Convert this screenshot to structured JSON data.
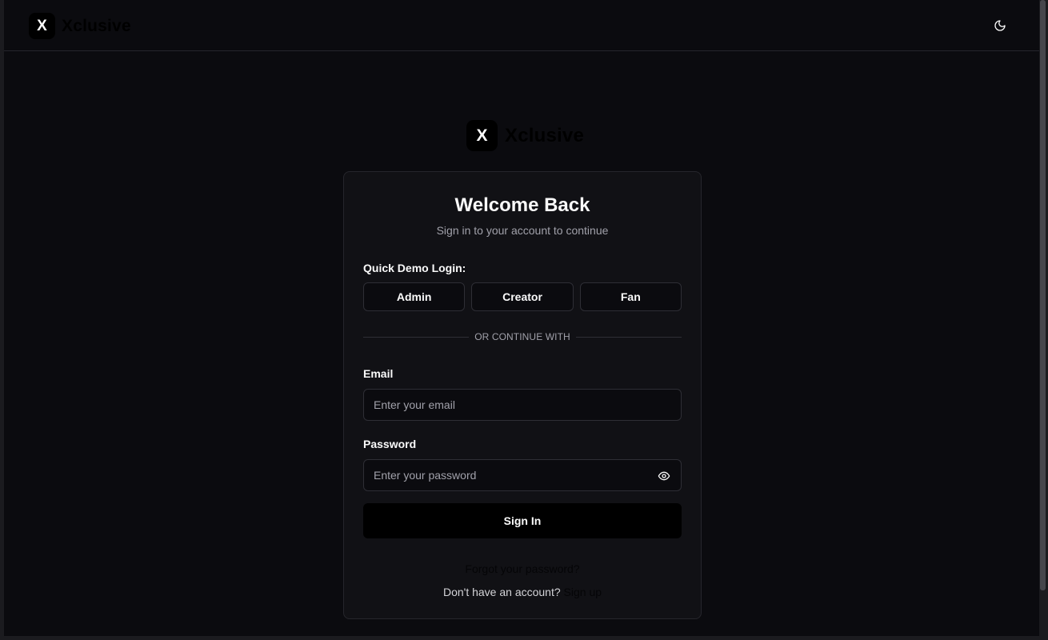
{
  "header": {
    "logo_letter": "X",
    "brand": "Xclusive",
    "theme_icon": "moon-icon"
  },
  "center_logo": {
    "logo_letter": "X",
    "brand": "Xclusive"
  },
  "card": {
    "title": "Welcome Back",
    "subtitle": "Sign in to your account to continue",
    "demo_label": "Quick Demo Login:",
    "demo_buttons": [
      "Admin",
      "Creator",
      "Fan"
    ],
    "divider_text": "OR CONTINUE WITH",
    "email": {
      "label": "Email",
      "placeholder": "Enter your email",
      "value": ""
    },
    "password": {
      "label": "Password",
      "placeholder": "Enter your password",
      "value": "",
      "toggle_icon": "eye-icon"
    },
    "submit_label": "Sign In",
    "forgot_label": "Forgot your password?",
    "no_account_text": "Don't have an account?",
    "signup_label": "Sign up"
  },
  "colors": {
    "background": "#0b0b0f",
    "card": "#111115",
    "border": "#26262c",
    "primary_button": "#000000",
    "muted_text": "#a1a1aa"
  }
}
